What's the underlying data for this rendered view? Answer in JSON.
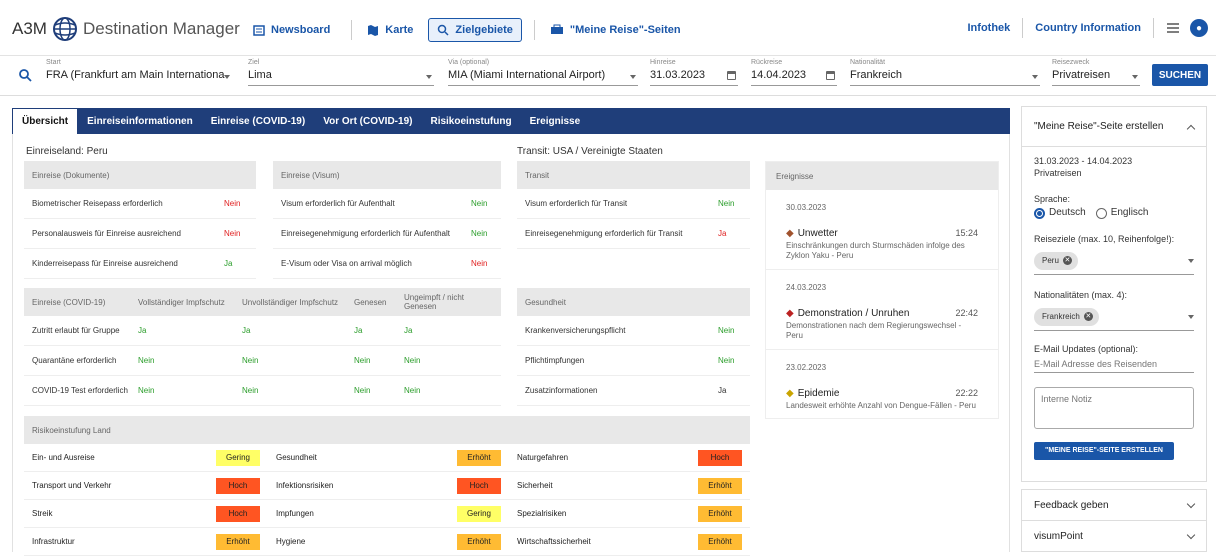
{
  "app": {
    "logo_prefix": "A3M",
    "title": "Destination Manager"
  },
  "nav": {
    "newsboard": "Newsboard",
    "karte": "Karte",
    "zielgebiete": "Zielgebiete",
    "meine_reise": "\"Meine Reise\"-Seiten"
  },
  "right_nav": {
    "infothek": "Infothek",
    "country_info": "Country Information"
  },
  "search": {
    "start_label": "Start",
    "start_value": "FRA (Frankfurt am Main Internationa",
    "ziel_label": "Ziel",
    "ziel_value": "Lima",
    "via_label": "Via (optional)",
    "via_value": "MIA (Miami International Airport)",
    "hinreise_label": "Hinreise",
    "hinreise_value": "31.03.2023",
    "rueckreise_label": "Rückreise",
    "rueckreise_value": "14.04.2023",
    "nat_label": "Nationalität",
    "nat_value": "Frankreich",
    "zweck_label": "Reisezweck",
    "zweck_value": "Privatreisen",
    "search_button": "SUCHEN"
  },
  "tabs": [
    "Übersicht",
    "Einreiseinformationen",
    "Einreise (COVID-19)",
    "Vor Ort (COVID-19)",
    "Risikoeinstufung",
    "Ereignisse"
  ],
  "einreiseland": "Einreiseland: Peru",
  "transit_label": "Transit: USA / Vereinigte Staaten",
  "dokumente": {
    "header": "Einreise (Dokumente)",
    "rows": [
      {
        "k": "Biometrischer Reisepass erforderlich",
        "v": "Nein"
      },
      {
        "k": "Personalausweis für Einreise ausreichend",
        "v": "Nein"
      },
      {
        "k": "Kinderreisepass für Einreise ausreichend",
        "v": "Ja"
      }
    ]
  },
  "visum": {
    "header": "Einreise (Visum)",
    "rows": [
      {
        "k": "Visum erforderlich für Aufenthalt",
        "v": "Nein"
      },
      {
        "k": "Einreisegenehmigung erforderlich für Aufenthalt",
        "v": "Nein"
      },
      {
        "k": "E-Visum oder Visa on arrival möglich",
        "v": "Nein"
      }
    ]
  },
  "transit": {
    "header": "Transit",
    "rows": [
      {
        "k": "Visum erforderlich für Transit",
        "v": "Nein"
      },
      {
        "k": "Einreisegenehmigung erforderlich für Transit",
        "v": "Ja"
      }
    ]
  },
  "covid": {
    "header": "Einreise (COVID-19)",
    "cols": [
      "Vollständiger Impfschutz",
      "Unvollständiger Impfschutz",
      "Genesen",
      "Ungeimpft / nicht Genesen"
    ],
    "rows": [
      {
        "k": "Zutritt erlaubt für Gruppe",
        "v": [
          "Ja",
          "Ja",
          "Ja",
          "Ja"
        ]
      },
      {
        "k": "Quarantäne erforderlich",
        "v": [
          "Nein",
          "Nein",
          "Nein",
          "Nein"
        ]
      },
      {
        "k": "COVID-19 Test erforderlich",
        "v": [
          "Nein",
          "Nein",
          "Nein",
          "Nein"
        ]
      }
    ]
  },
  "gesundheit": {
    "header": "Gesundheit",
    "rows": [
      {
        "k": "Krankenversicherungspflicht",
        "v": "Nein"
      },
      {
        "k": "Pflichtimpfungen",
        "v": "Nein"
      },
      {
        "k": "Zusatzinformationen",
        "v": "Ja"
      }
    ]
  },
  "ereignisse": {
    "header": "Ereignisse",
    "groups": [
      {
        "date": "30.03.2023",
        "title": "Unwetter",
        "time": "15:24",
        "desc": "Einschränkungen durch Sturmschäden infolge des Zyklon Yaku - Peru"
      },
      {
        "date": "24.03.2023",
        "title": "Demonstration / Unruhen",
        "time": "22:42",
        "desc": "Demonstrationen nach dem Regierungswechsel - Peru"
      },
      {
        "date": "23.02.2023",
        "title": "Epidemie",
        "time": "22:22",
        "desc": "Landesweit erhöhte Anzahl von Dengue-Fällen - Peru"
      }
    ]
  },
  "risiko": {
    "header": "Risikoeinstufung Land",
    "rows": [
      [
        {
          "k": "Ein- und Ausreise",
          "v": "Gering",
          "c": "#ffff66"
        },
        {
          "k": "Gesundheit",
          "v": "Erhöht",
          "c": "#ffbb33"
        },
        {
          "k": "Naturgefahren",
          "v": "Hoch",
          "c": "#ff5522"
        }
      ],
      [
        {
          "k": "Transport und Verkehr",
          "v": "Hoch",
          "c": "#ff5522"
        },
        {
          "k": "Infektionsrisiken",
          "v": "Hoch",
          "c": "#ff5522"
        },
        {
          "k": "Sicherheit",
          "v": "Erhöht",
          "c": "#ffbb33"
        }
      ],
      [
        {
          "k": "Streik",
          "v": "Hoch",
          "c": "#ff5522"
        },
        {
          "k": "Impfungen",
          "v": "Gering",
          "c": "#ffff66"
        },
        {
          "k": "Spezialrisiken",
          "v": "Erhöht",
          "c": "#ffbb33"
        }
      ],
      [
        {
          "k": "Infrastruktur",
          "v": "Erhöht",
          "c": "#ffbb33"
        },
        {
          "k": "Hygiene",
          "v": "Erhöht",
          "c": "#ffbb33"
        },
        {
          "k": "Wirtschaftssicherheit",
          "v": "Erhöht",
          "c": "#ffbb33"
        }
      ]
    ]
  },
  "sidebar": {
    "title": "\"Meine Reise\"-Seite erstellen",
    "dates": "31.03.2023 - 14.04.2023",
    "purpose": "Privatreisen",
    "sprache_label": "Sprache:",
    "lang_de": "Deutsch",
    "lang_en": "Englisch",
    "reiseziele_label": "Reiseziele (max. 10, Reihenfolge!):",
    "reiseziel_chip": "Peru",
    "nat_label": "Nationalitäten (max. 4):",
    "nat_chip": "Frankreich",
    "email_label": "E-Mail Updates (optional):",
    "email_placeholder": "E-Mail Adresse des Reisenden",
    "notiz_placeholder": "Interne Notiz",
    "create_button": "\"MEINE REISE\"-SEITE ERSTELLEN",
    "feedback": "Feedback geben",
    "visumpoint": "visumPoint"
  },
  "colors": {
    "brand": "#1a56a8",
    "tabbar": "#1f3e7a",
    "yes": "#2a9d2a",
    "no": "#e02020"
  }
}
